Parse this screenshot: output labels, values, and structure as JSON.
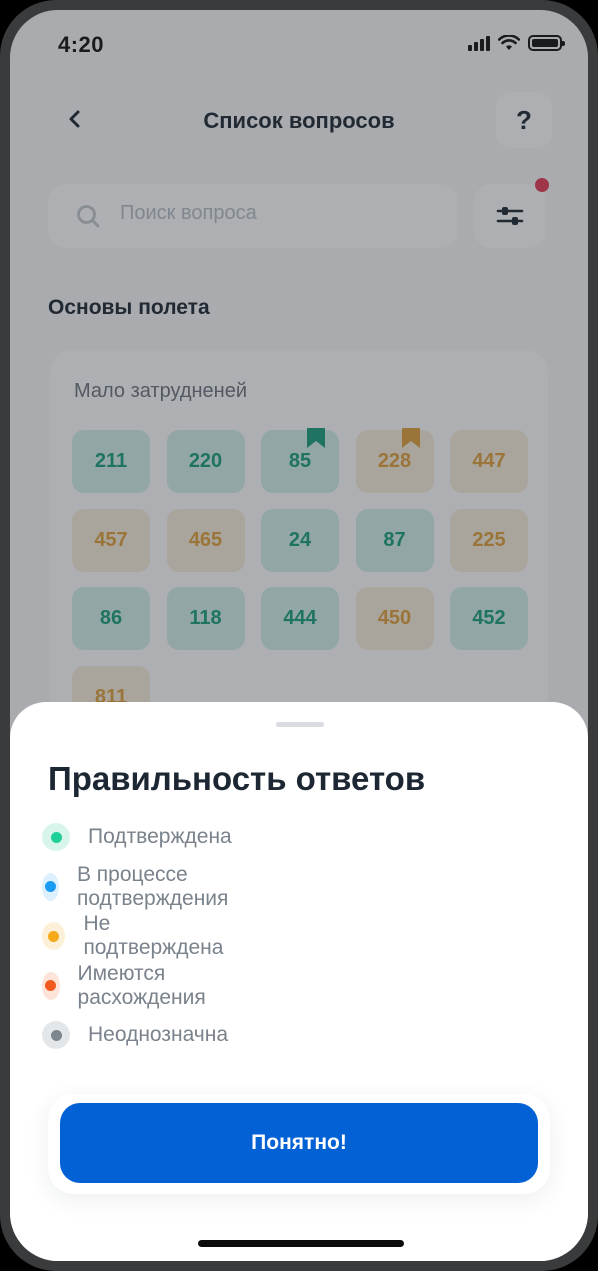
{
  "status_bar": {
    "time": "4:20",
    "icons": [
      "signal-icon",
      "wifi-icon",
      "battery-icon"
    ]
  },
  "header": {
    "title": "Список вопросов",
    "back_icon": "chevron-left-icon",
    "help_label": "?"
  },
  "search": {
    "placeholder": "Поиск вопроса",
    "icon": "search-icon",
    "filter_icon": "sliders-icon",
    "filter_badge_color": "#e83a56"
  },
  "section": {
    "title": "Основы полета",
    "group_label": "Мало затрудненей",
    "questions": [
      {
        "number": "211",
        "status": "green",
        "bookmark": false
      },
      {
        "number": "220",
        "status": "green",
        "bookmark": false
      },
      {
        "number": "85",
        "status": "green",
        "bookmark": true
      },
      {
        "number": "228",
        "status": "orange",
        "bookmark": true
      },
      {
        "number": "447",
        "status": "orange",
        "bookmark": false
      },
      {
        "number": "457",
        "status": "orange",
        "bookmark": false
      },
      {
        "number": "465",
        "status": "orange",
        "bookmark": false
      },
      {
        "number": "24",
        "status": "green",
        "bookmark": false
      },
      {
        "number": "87",
        "status": "green",
        "bookmark": false
      },
      {
        "number": "225",
        "status": "orange",
        "bookmark": false
      },
      {
        "number": "86",
        "status": "green",
        "bookmark": false
      },
      {
        "number": "118",
        "status": "green",
        "bookmark": false
      },
      {
        "number": "444",
        "status": "green",
        "bookmark": false
      },
      {
        "number": "450",
        "status": "orange",
        "bookmark": false
      },
      {
        "number": "452",
        "status": "green",
        "bookmark": false
      },
      {
        "number": "811",
        "status": "orange",
        "bookmark": false
      }
    ]
  },
  "sheet": {
    "title": "Правильность ответов",
    "legend": [
      {
        "label": "Подтверждена",
        "color": "#1fcf98",
        "bg": "#d8f5ec"
      },
      {
        "label": "В процессе подтверждения",
        "color": "#1a9cf5",
        "bg": "#dcf0fd"
      },
      {
        "label": "Не подтверждена",
        "color": "#f6a91b",
        "bg": "#fdf0d8"
      },
      {
        "label": "Имеются расхождения",
        "color": "#f2591e",
        "bg": "#fde3d8"
      },
      {
        "label": "Неоднозначна",
        "color": "#7c868f",
        "bg": "#e4e7ea"
      }
    ],
    "confirm_label": "Понятно!"
  },
  "colors": {
    "accent": "#0261d4",
    "green_text": "#1aa07d",
    "orange_text": "#e0a13c"
  }
}
